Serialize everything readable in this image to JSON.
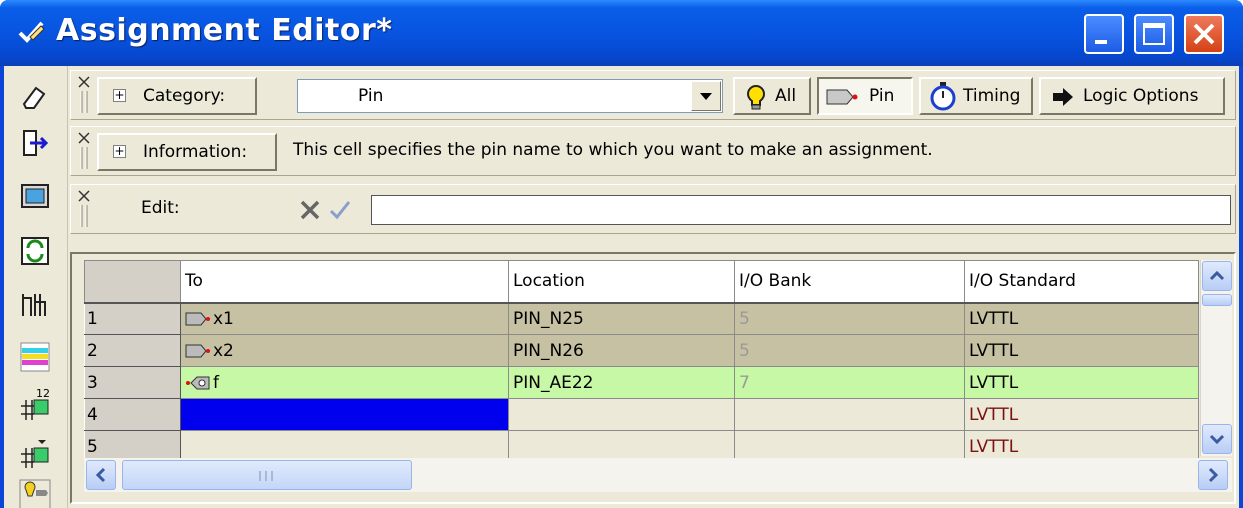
{
  "window": {
    "title": "Assignment Editor*"
  },
  "title_buttons": [
    "minimize",
    "maximize",
    "close"
  ],
  "left_toolbar": {
    "icons": [
      "eraser-icon",
      "export-arrow-icon",
      "display-icon",
      "refresh-icon",
      "node-finder-icon",
      "color-legend-icon",
      "sort-ascending-icon",
      "sort-descending-icon",
      "pin-planner-icon"
    ]
  },
  "category_bar": {
    "toggle": "+",
    "button_label": "Category:",
    "selected_value": "Pin",
    "filters": [
      {
        "label": "All",
        "icon": "lightbulb-icon"
      },
      {
        "label": "Pin",
        "icon": "pin-icon"
      },
      {
        "label": "Timing",
        "icon": "stopwatch-icon"
      },
      {
        "label": "Logic Options",
        "icon": "arrow-right-icon"
      }
    ]
  },
  "information_bar": {
    "toggle": "+",
    "button_label": "Information:",
    "text": "This cell specifies the pin name to which you want to make an assignment."
  },
  "edit_bar": {
    "label": "Edit:",
    "value": ""
  },
  "grid": {
    "columns": [
      "To",
      "Location",
      "I/O Bank",
      "I/O Standard"
    ],
    "rows": [
      {
        "num": "1",
        "to": "x1",
        "location": "PIN_N25",
        "bank": "5",
        "standard": "LVTTL",
        "kind": "input"
      },
      {
        "num": "2",
        "to": "x2",
        "location": "PIN_N26",
        "bank": "5",
        "standard": "LVTTL",
        "kind": "input"
      },
      {
        "num": "3",
        "to": "f",
        "location": "PIN_AE22",
        "bank": "7",
        "standard": "LVTTL",
        "kind": "output"
      },
      {
        "num": "4",
        "to": "",
        "location": "",
        "bank": "",
        "standard": "LVTTL",
        "kind": "new"
      },
      {
        "num": "5",
        "to": "",
        "location": "",
        "bank": "",
        "standard": "LVTTL",
        "kind": "new"
      }
    ]
  },
  "colors": {
    "title_bar": "#0854e0",
    "assigned_input_row": "#c6c1a2",
    "assigned_output_row": "#c6f8a5",
    "selection": "#0000ee"
  }
}
